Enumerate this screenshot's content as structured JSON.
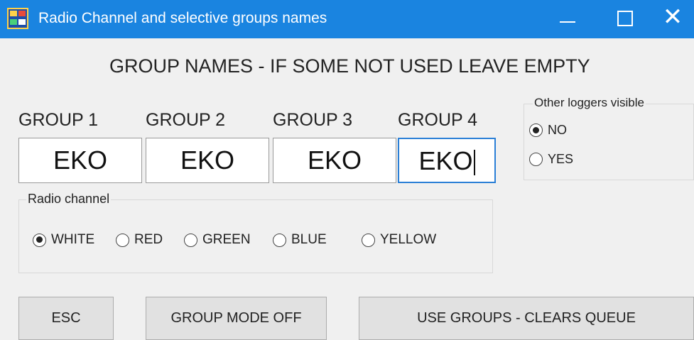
{
  "window": {
    "title": "Radio Channel and selective groups names",
    "icon": "app-icon",
    "controls": [
      "minimize-icon",
      "maximize-icon",
      "close-icon"
    ],
    "close_glyph": "✕",
    "accent_color": "#1a84e0"
  },
  "heading": "GROUP NAMES - IF SOME NOT USED LEAVE EMPTY",
  "groups": [
    {
      "label": "GROUP 1",
      "value": "EKO"
    },
    {
      "label": "GROUP 2",
      "value": "EKO"
    },
    {
      "label": "GROUP 3",
      "value": "EKO"
    },
    {
      "label": "GROUP 4",
      "value": "EKO",
      "focused": true
    }
  ],
  "other_loggers": {
    "legend": "Other loggers visible",
    "options": [
      "NO",
      "YES"
    ],
    "selected": "NO"
  },
  "radio_channel": {
    "legend": "Radio channel",
    "options": [
      "WHITE",
      "RED",
      "GREEN",
      "BLUE",
      "YELLOW"
    ],
    "selected": "WHITE"
  },
  "buttons": {
    "esc": "ESC",
    "group_mode_off": "GROUP MODE OFF",
    "use_groups": "USE GROUPS - CLEARS QUEUE"
  }
}
